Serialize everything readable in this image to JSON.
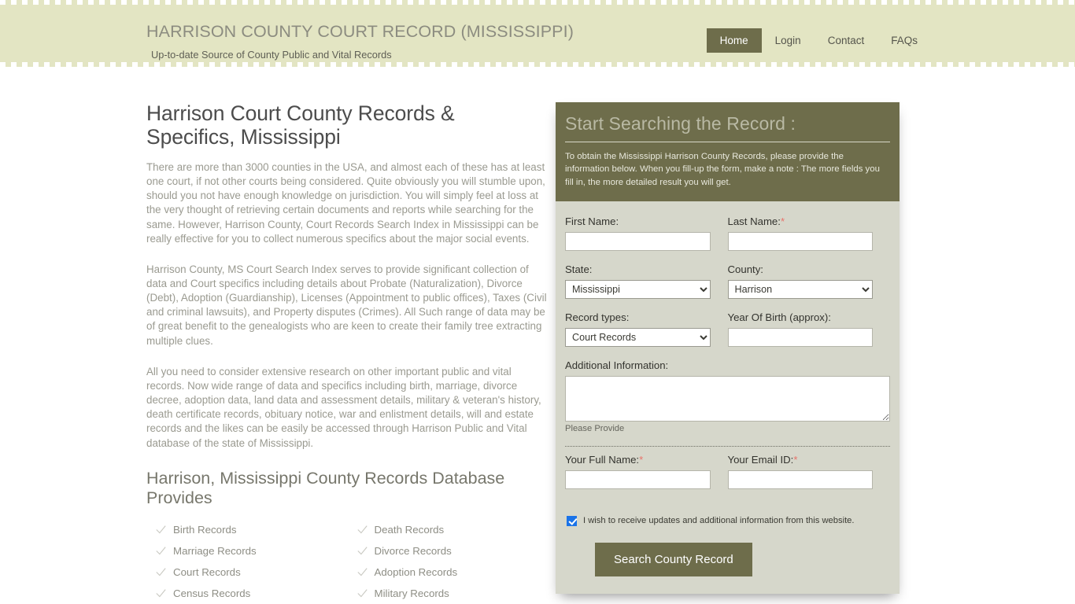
{
  "header": {
    "brand_title": "HARRISON COUNTY COURT RECORD (MISSISSIPPI)",
    "brand_tagline": "Up-to-date Source of  County Public and Vital Records",
    "nav": [
      {
        "label": "Home",
        "active": true
      },
      {
        "label": "Login",
        "active": false
      },
      {
        "label": "Contact",
        "active": false
      },
      {
        "label": "FAQs",
        "active": false
      }
    ]
  },
  "content": {
    "title": "Harrison Court County Records & Specifics, Mississippi",
    "paragraphs": [
      "There are more than 3000 counties in the USA, and almost each of these has at least one court, if not other courts being considered. Quite obviously you will stumble upon, should you not have enough knowledge on jurisdiction. You will simply feel at loss at the very thought of retrieving certain documents and reports while searching for the same. However, Harrison County, Court Records Search Index in Mississippi can be really effective for you to collect numerous specifics about the major social events.",
      "Harrison County, MS Court Search Index serves to provide significant collection of data and Court specifics including details about Probate (Naturalization), Divorce (Debt), Adoption (Guardianship), Licenses (Appointment to public offices), Taxes (Civil and criminal lawsuits), and Property disputes (Crimes). All Such range of data may be of great benefit to the genealogists who are keen to create their family tree extracting multiple clues.",
      "All you need to consider extensive research on other important public and vital records. Now wide range of data and specifics including birth, marriage, divorce decree, adoption data, land data and assessment details, military & veteran's history, death certificate records, obituary notice, war and enlistment details, will and estate records and the likes can be easily be accessed through Harrison Public and Vital database of the state of Mississippi."
    ],
    "section_title": "Harrison, Mississippi County Records Database Provides",
    "records": [
      "Birth Records",
      "Death Records",
      "Marriage Records",
      "Divorce Records",
      "Court Records",
      "Adoption Records",
      "Census Records",
      "Military Records"
    ]
  },
  "form": {
    "panel_title": "Start Searching the Record :",
    "panel_description": "To obtain the Mississippi Harrison County Records, please provide the information below. When you fill-up the form, make a note : The more fields you fill in, the more detailed result you will get.",
    "first_name_label": "First Name:",
    "first_name_value": "",
    "last_name_label": "Last Name:",
    "last_name_value": "",
    "state_label": "State:",
    "state_value": "Mississippi",
    "county_label": "County:",
    "county_value": "Harrison",
    "record_types_label": "Record types:",
    "record_types_value": "Court Records",
    "year_of_birth_label": "Year Of Birth (approx):",
    "year_of_birth_value": "",
    "additional_info_label": "Additional Information:",
    "additional_info_value": "",
    "additional_info_hint": "Please Provide",
    "full_name_label": "Your Full Name:",
    "full_name_value": "",
    "email_label": "Your Email ID:",
    "email_value": "",
    "consent_label": "I wish to receive updates and additional information from this website.",
    "consent_checked": true,
    "submit_label": "Search County Record",
    "required_marker": "*"
  },
  "colors": {
    "header_band": "#e3e5c3",
    "olive": "#6e6d4b",
    "panel_body": "#d6d7cb",
    "required_red": "#e8736a",
    "checkbox_blue": "#1a73e8"
  }
}
